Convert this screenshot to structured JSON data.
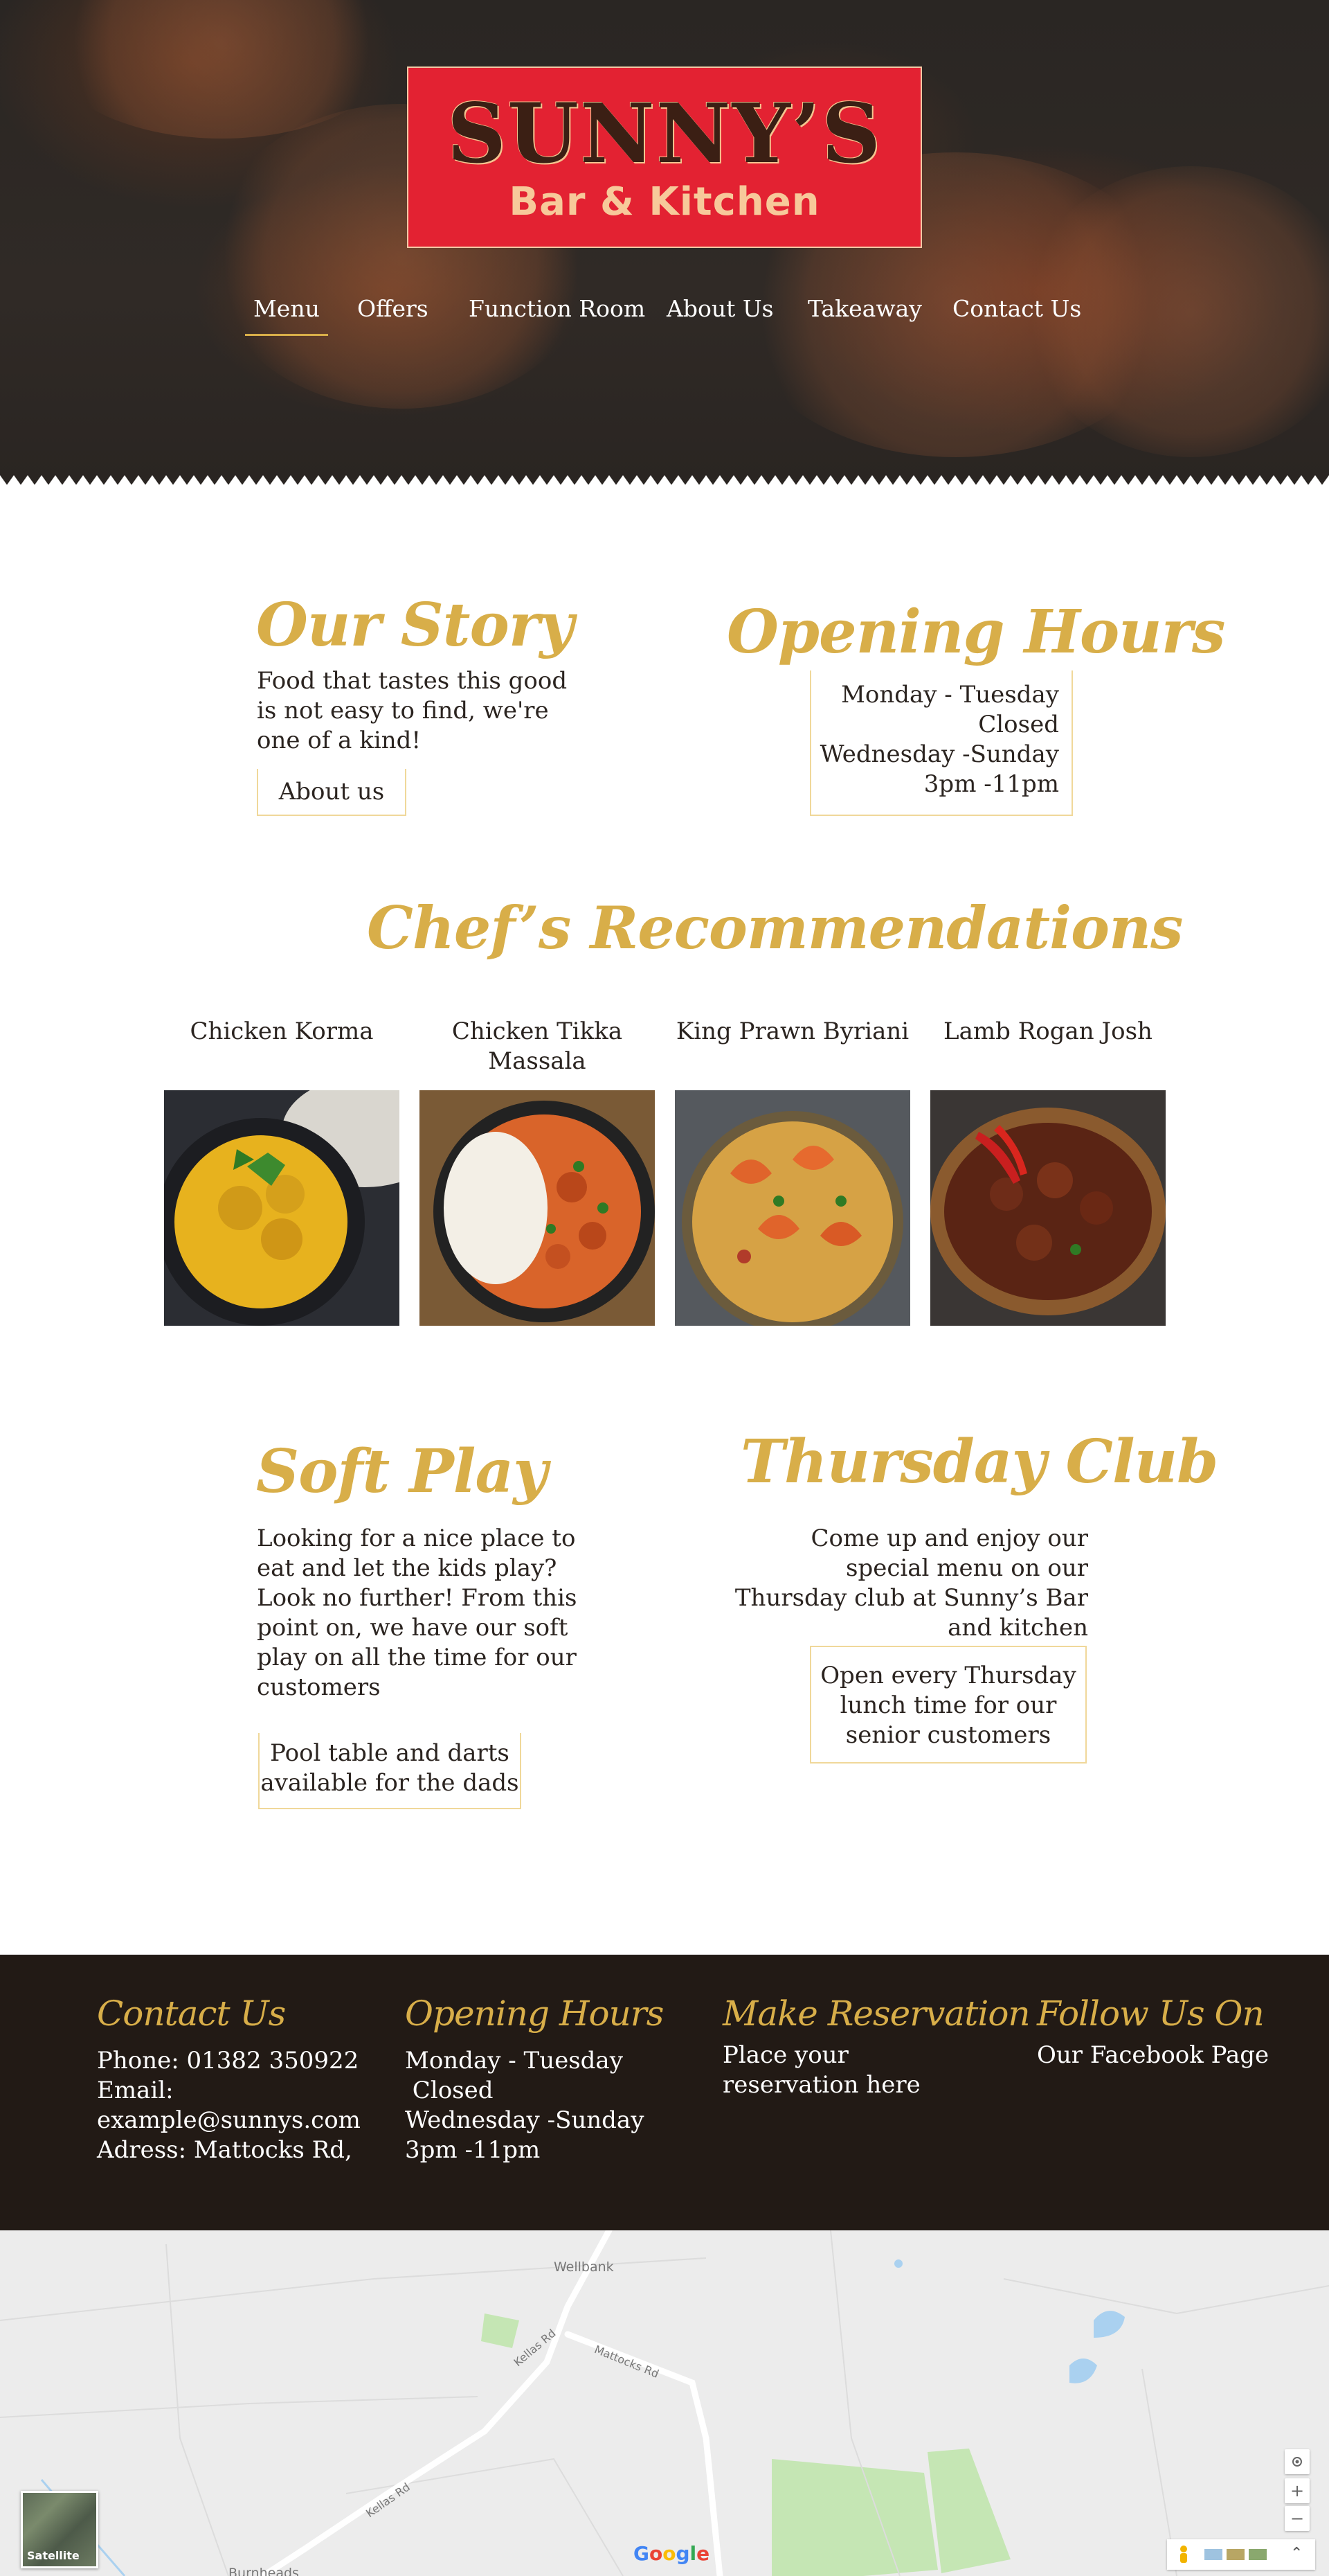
{
  "logo": {
    "name": "SUNNY’S",
    "subtitle": "Bar & Kitchen"
  },
  "nav": [
    {
      "label": "Menu",
      "active": true
    },
    {
      "label": "Offers"
    },
    {
      "label": "Function Room"
    },
    {
      "label": "About Us"
    },
    {
      "label": "Takeaway"
    },
    {
      "label": "Contact Us"
    }
  ],
  "story": {
    "title": "Our Story",
    "text": "Food that tastes this good is not easy to find, we're one of a kind!",
    "button": "About us"
  },
  "hours": {
    "title": "Opening Hours",
    "lines": [
      "Monday - Tuesday",
      "Closed",
      "Wednesday -Sunday",
      "3pm -11pm"
    ]
  },
  "chef": {
    "title": "Chef’s Recommendations",
    "dishes": [
      {
        "name": "Chicken Korma",
        "image": "korma-image"
      },
      {
        "name": "Chicken Tikka Massala",
        "image": "tikka-masala-image"
      },
      {
        "name": "King Prawn Byriani",
        "image": "prawn-byriani-image"
      },
      {
        "name": "Lamb Rogan Josh",
        "image": "rogan-josh-image"
      }
    ]
  },
  "softplay": {
    "title": "Soft Play",
    "text": "Looking for a nice place to eat and let the kids play?\nLook no further! From this point on, we have our soft play on all the time for our customers",
    "box": "Pool table and darts available for the dads"
  },
  "thursday": {
    "title": "Thursday Club",
    "text": "Come up and enjoy our special menu on our Thursday club at Sunny’s Bar and kitchen",
    "box": "Open every Thursday lunch time for our senior customers"
  },
  "footer": {
    "contact": {
      "title": "Contact Us",
      "phone": "Phone: 01382 350922",
      "email_label": "Email:",
      "email": "example@sunnys.com",
      "address": "Adress: Mattocks Rd,"
    },
    "hours": {
      "title": "Opening Hours",
      "lines": [
        "Monday - Tuesday",
        " Closed",
        "Wednesday -Sunday",
        "3pm -11pm"
      ]
    },
    "reservation": {
      "title": "Make Reservation",
      "text": "Place your reservation here"
    },
    "follow": {
      "title": "Follow Us On",
      "text": "Our Facebook Page"
    }
  },
  "map": {
    "labels": [
      "Wellbank",
      "Kellas Rd",
      "Mattocks Rd",
      "Kellas Rd",
      "Burnheads"
    ],
    "satellite_label": "Satellite",
    "google_logo": "Google",
    "controls": [
      "locate-icon",
      "zoom-in-icon",
      "zoom-out-icon",
      "pegman-icon",
      "expand-icon"
    ],
    "colors": {
      "road": "#ffffff",
      "green": "#c5e6b4",
      "water": "#aad1f0",
      "land": "#ececec"
    }
  },
  "colors": {
    "accent_gold": "#d8ae49",
    "logo_red": "#e32232",
    "footer_bg": "#221a15"
  }
}
